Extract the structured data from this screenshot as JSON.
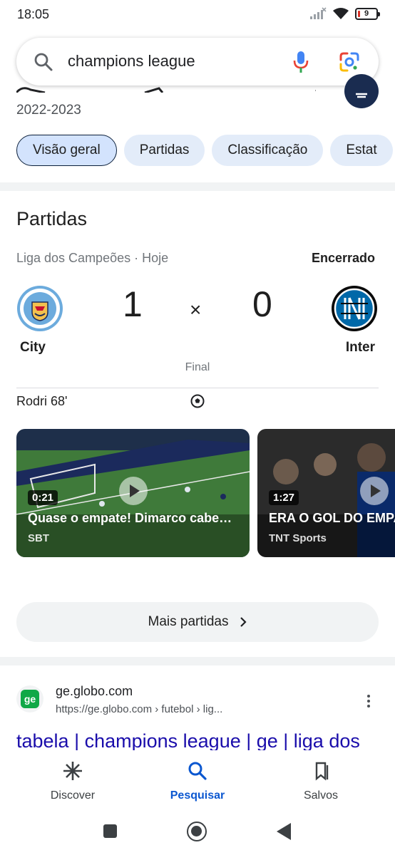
{
  "status_bar": {
    "time": "18:05",
    "battery": "9"
  },
  "search": {
    "query": "champions league"
  },
  "header": {
    "season": "2022-2023"
  },
  "chips": [
    {
      "label": "Visão geral"
    },
    {
      "label": "Partidas"
    },
    {
      "label": "Classificação"
    },
    {
      "label": "Estat"
    }
  ],
  "matches": {
    "title": "Partidas",
    "league_line": "Liga dos Campeões · Hoje",
    "status": "Encerrado",
    "home": {
      "name": "City",
      "score": "1"
    },
    "away": {
      "name": "Inter",
      "score": "0"
    },
    "separator": "×",
    "stage": "Final",
    "scorer": "Rodri 68'"
  },
  "videos": [
    {
      "duration": "0:21",
      "title": "Quase o empate! Dimarco cabe…",
      "source": "SBT"
    },
    {
      "duration": "1:27",
      "title": "ERA O GOL DO EMPA",
      "source": "TNT Sports"
    }
  ],
  "more_button": {
    "label": "Mais partidas"
  },
  "result": {
    "favicon_text": "ge",
    "site": "ge.globo.com",
    "url": "https://ge.globo.com › futebol › lig...",
    "title": "tabela | champions league | ge | liga dos"
  },
  "bottom_nav": [
    {
      "label": "Discover"
    },
    {
      "label": "Pesquisar"
    },
    {
      "label": "Salvos"
    }
  ],
  "colors": {
    "accent": "#0b57d0",
    "link": "#1a0dab",
    "chip_bg": "#e3ecf9"
  }
}
